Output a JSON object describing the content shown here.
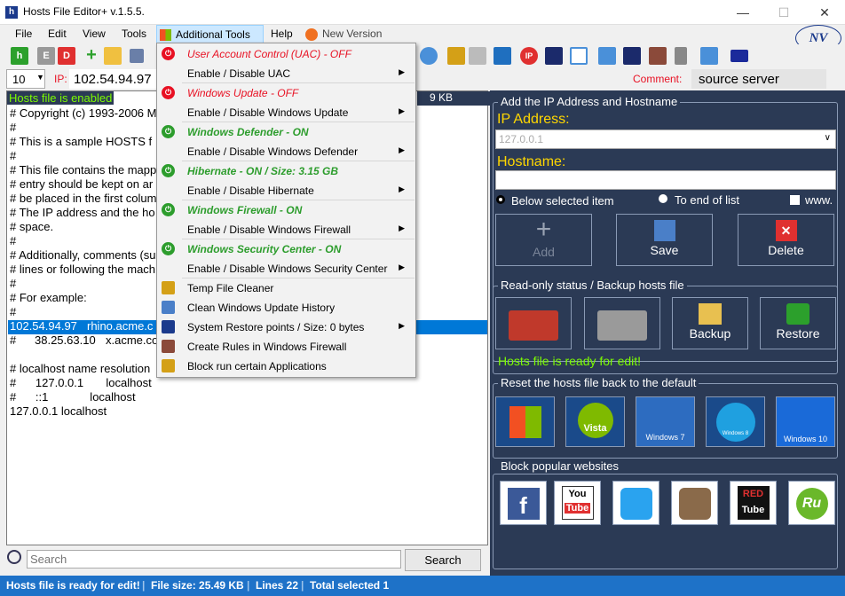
{
  "window": {
    "title": "Hosts File Editor+ v.1.5.5.",
    "minimize": "—",
    "maximize": "☐",
    "close": "✕"
  },
  "menubar": {
    "file": "File",
    "edit": "Edit",
    "view": "View",
    "tools": "Tools",
    "additional": "Additional Tools",
    "help": "Help",
    "new_version": "New Version"
  },
  "ipbar": {
    "count": "10",
    "ip_label": "IP:",
    "ip_value": "102.54.94.97",
    "comment_label": "Comment:",
    "comment_value": "source server"
  },
  "hosts": {
    "status": "Hosts file is enabled",
    "size_fragment": "9 KB",
    "lines": [
      "# Copyright (c) 1993-2006 Mi",
      "#",
      "# This is a sample HOSTS f",
      "#",
      "# This file contains the mapp",
      "# entry should be kept on ar",
      "# be placed in the first colum",
      "# The IP address and the ho",
      "# space.",
      "#",
      "# Additionally, comments (su",
      "# lines or following the mach",
      "#",
      "# For example:",
      "#"
    ],
    "selected_ip": "102.54.94.97",
    "selected_host": "rhino.acme.c",
    "line_ip2": "38.25.63.10",
    "line_host2": "x.acme.co",
    "lines2": [
      "# localhost name resolution",
      "#      127.0.0.1       localhost",
      "#      ::1             localhost",
      "127.0.0.1 localhost"
    ]
  },
  "search": {
    "placeholder": "Search",
    "button": "Search"
  },
  "right": {
    "add_group": "Add the IP Address  and Hostname",
    "ip_label": "IP Address:",
    "ip_value": "127.0.0.1",
    "hostname_label": "Hostname:",
    "radio_below": "Below selected item",
    "radio_end": "To end of list",
    "www": "www.",
    "add": "Add",
    "save": "Save",
    "delete": "Delete",
    "readonly_group": "Read-only status / Backup hosts file",
    "backup": "Backup",
    "restore": "Restore",
    "ready": "Hosts file is ready for edit!",
    "reset_group": "Reset the hosts file back to the default",
    "os_vista": "Vista",
    "os_win7": "Windows 7",
    "os_win8": "Windows 8",
    "os_win10": "Windows 10",
    "block_group": "Block popular websites",
    "yt1": "You",
    "yt2": "Tube",
    "red1": "RED",
    "red2": "Tube",
    "ru": "Ru"
  },
  "menu": {
    "items": [
      {
        "label": "User Account Control (UAC) - OFF",
        "state": "off"
      },
      {
        "label": "Enable / Disable UAC"
      },
      {
        "label": "Windows Update - OFF",
        "state": "off"
      },
      {
        "label": "Enable / Disable Windows Update"
      },
      {
        "label": "Windows Defender - ON",
        "state": "on"
      },
      {
        "label": "Enable / Disable Windows Defender"
      },
      {
        "label": "Hibernate - ON / Size: 3.15 GB",
        "state": "on"
      },
      {
        "label": "Enable / Disable Hibernate"
      },
      {
        "label": "Windows Firewall - ON",
        "state": "on"
      },
      {
        "label": "Enable / Disable Windows Firewall"
      },
      {
        "label": "Windows Security Center - ON",
        "state": "on"
      },
      {
        "label": "Enable / Disable Windows Security Center"
      },
      {
        "label": "Temp File Cleaner"
      },
      {
        "label": "Clean Windows Update History"
      },
      {
        "label": "System Restore points / Size:   0 bytes"
      },
      {
        "label": "Create Rules in Windows Firewall"
      },
      {
        "label": "Block run certain Applications"
      }
    ]
  },
  "status": {
    "ready": "Hosts file is ready for edit!",
    "size": "File size:  25.49 KB",
    "lines": "Lines 22",
    "selected": "Total selected 1"
  },
  "colors": {
    "accent": "#1e72c8",
    "panel": "#2b3a55",
    "off": "#e81123",
    "on": "#2d9d2d"
  }
}
